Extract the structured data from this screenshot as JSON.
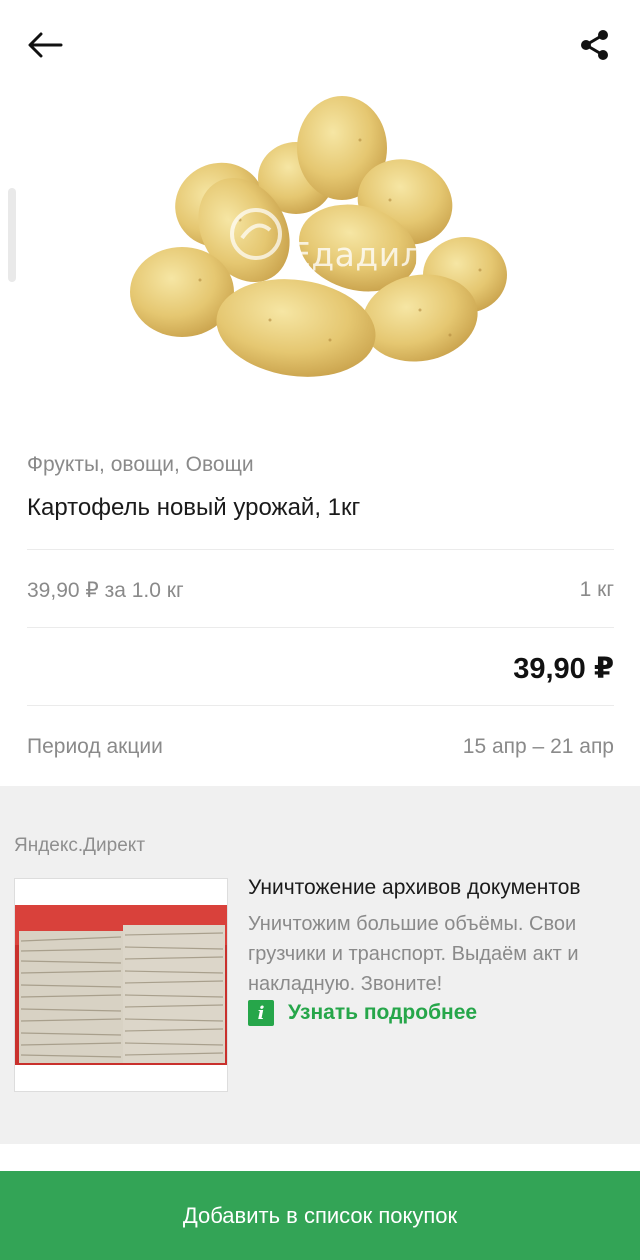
{
  "product": {
    "watermark": "Едадил",
    "category": "Фрукты, овощи, Овощи",
    "title": "Картофель новый урожай, 1кг",
    "unit_price": "39,90 ₽ за 1.0 кг",
    "quantity": "1 кг",
    "total": "39,90 ₽",
    "period_label": "Период акции",
    "period_value": "15 апр – 21 апр"
  },
  "ad": {
    "label": "Яндекс.Директ",
    "title": "Уничтожение архивов документов",
    "desc_line1": "Уничтожим большие объёмы. Свои",
    "desc_line2": "грузчики и транспорт. Выдаём акт и",
    "desc_line3": "накладную. Звоните!",
    "link": "Узнать подробнее"
  },
  "actions": {
    "add_to_list": "Добавить в список покупок"
  },
  "icons": {
    "back": "arrow-left-icon",
    "share": "share-icon",
    "info": "info-icon"
  },
  "colors": {
    "accent_green": "#33a456",
    "ad_background": "#f0f0f0"
  }
}
